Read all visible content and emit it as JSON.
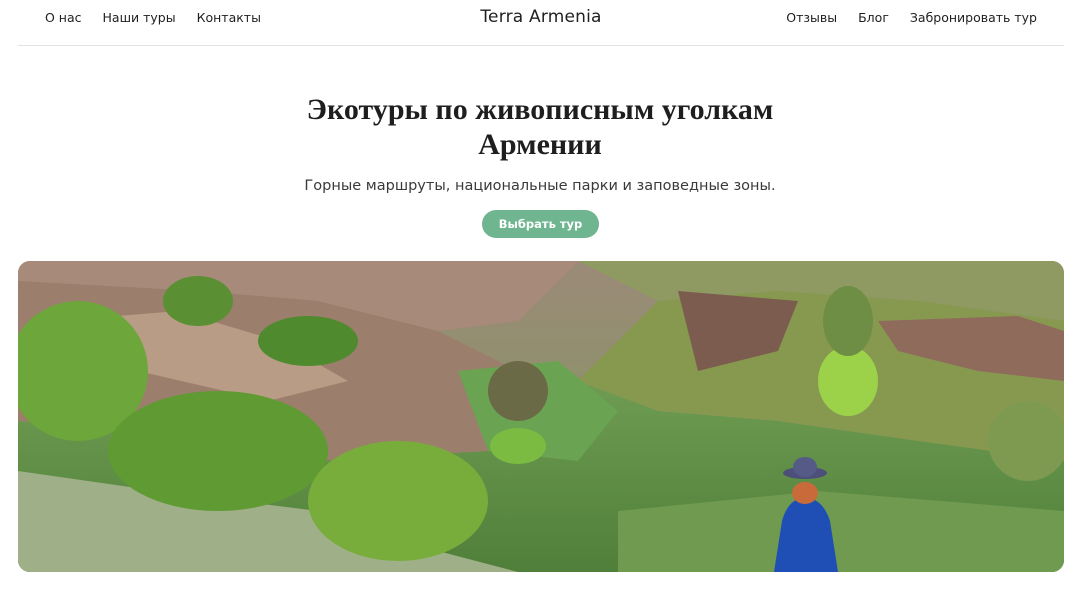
{
  "header": {
    "nav_left": [
      "О нас",
      "Наши туры",
      "Контакты"
    ],
    "logo": "Terra Armenia",
    "nav_right": [
      "Отзывы",
      "Блог",
      "Забронировать тур"
    ]
  },
  "hero": {
    "title_line1": "Экотуры по живописным уголкам",
    "title_line2": "Армении",
    "subtitle": "Горные маршруты, национальные парки и заповедные зоны.",
    "cta_label": "Выбрать тур"
  },
  "colors": {
    "accent": "#6fb590",
    "text": "#1f1f1f",
    "divider": "#e3e3e3"
  },
  "image": {
    "semantic": "green valley landscape with woman in blue dress and hat"
  }
}
